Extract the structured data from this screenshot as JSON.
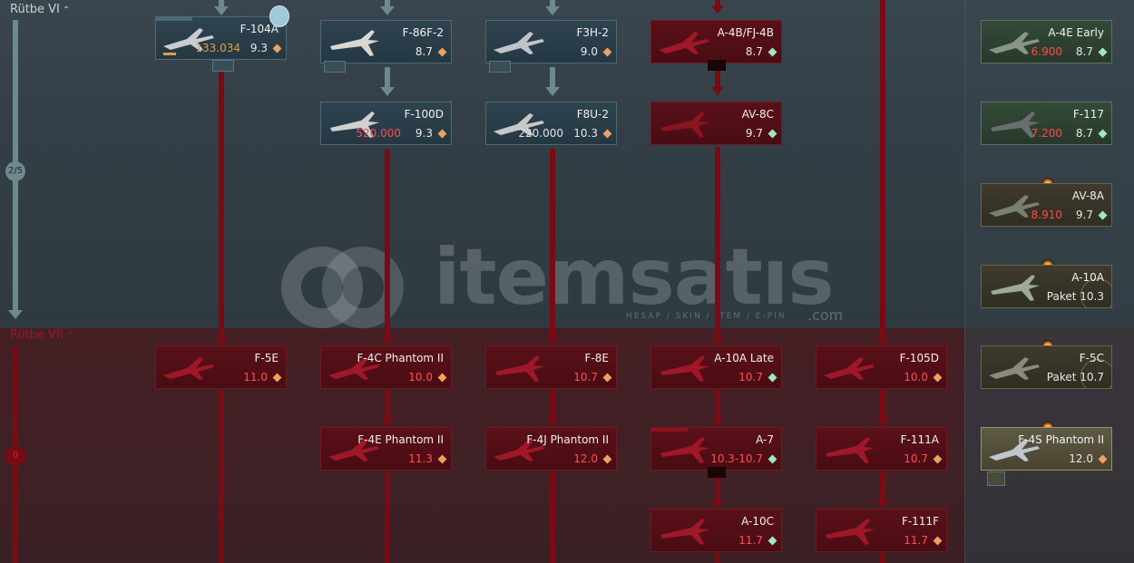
{
  "ranks": {
    "upper": {
      "label": "Rütbe VI",
      "progress": "2/5"
    },
    "lower": {
      "label": "Rütbe VII",
      "progress": "0"
    }
  },
  "watermark": {
    "brand": "itemsatıs",
    "tagline": "HESAP / SKIN / ITEM / E-PIN",
    "domain": ".com"
  },
  "colors": {
    "researched": "#2f4450",
    "locked": "#5a1018",
    "premium_green": "#334a38",
    "cost_red": "#ff4a4a",
    "br_gem": "#f0a060"
  },
  "vehicles": {
    "f104a": {
      "name": "F-104A",
      "cost": "133.034",
      "br": "9.3",
      "state": "researched"
    },
    "f86f2": {
      "name": "F-86F-2",
      "br": "8.7",
      "state": "researched"
    },
    "f3h2": {
      "name": "F3H-2",
      "br": "9.0",
      "state": "researched"
    },
    "a4b": {
      "name": "A-4B/FJ-4B",
      "br": "8.7",
      "state": "locked"
    },
    "f100d": {
      "name": "F-100D",
      "cost": "520.000",
      "br": "9.3",
      "state": "researched"
    },
    "f8u2": {
      "name": "F8U-2",
      "cost": "220.000",
      "br": "10.3",
      "state": "researched"
    },
    "av8c": {
      "name": "AV-8C",
      "br": "9.7",
      "state": "locked"
    },
    "f5e": {
      "name": "F-5E",
      "br": "11.0",
      "state": "locked"
    },
    "f4c": {
      "name": "F-4C Phantom II",
      "br": "10.0",
      "state": "locked"
    },
    "f8e": {
      "name": "F-8E",
      "br": "10.7",
      "state": "locked"
    },
    "a10late": {
      "name": "A-10A Late",
      "br": "10.7",
      "state": "locked"
    },
    "f105d": {
      "name": "F-105D",
      "br": "10.0",
      "state": "locked"
    },
    "f4e": {
      "name": "F-4E Phantom II",
      "br": "11.3",
      "state": "locked"
    },
    "f4j": {
      "name": "F-4J Phantom II",
      "br": "12.0",
      "state": "locked"
    },
    "a7": {
      "name": "A-7",
      "br": "10.3-10.7",
      "state": "locked"
    },
    "f111a": {
      "name": "F-111A",
      "br": "10.7",
      "state": "locked"
    },
    "a10c": {
      "name": "A-10C",
      "br": "11.7",
      "state": "locked"
    },
    "f111f": {
      "name": "F-111F",
      "br": "11.7",
      "state": "locked"
    }
  },
  "premium": {
    "a4e": {
      "name": "A-4E Early",
      "cost": "6.900",
      "br": "8.7"
    },
    "f117": {
      "name": "F-117",
      "cost": "7.200",
      "br": "8.7"
    },
    "av8a": {
      "name": "AV-8A",
      "cost": "8.910",
      "br": "9.7"
    },
    "a10a": {
      "name": "A-10A",
      "pack": "Paket 10.3"
    },
    "f5c": {
      "name": "F-5C",
      "pack": "Paket 10.7"
    },
    "f4s": {
      "name": "F-4S Phantom II",
      "br": "12.0"
    }
  }
}
